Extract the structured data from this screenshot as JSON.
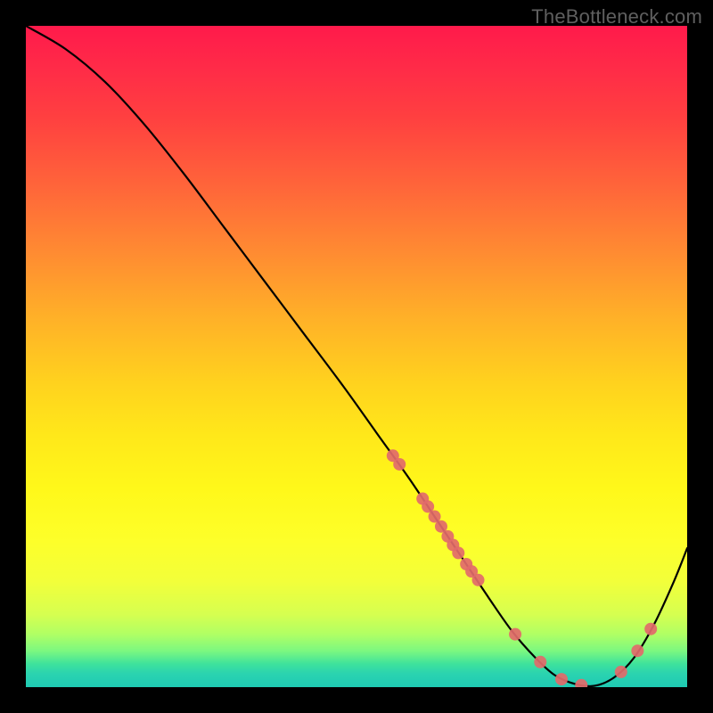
{
  "watermark": "TheBottleneck.com",
  "chart_data": {
    "type": "line",
    "title": "",
    "xlabel": "",
    "ylabel": "",
    "xlim": [
      0,
      100
    ],
    "ylim": [
      0,
      100
    ],
    "grid": false,
    "legend": false,
    "series": [
      {
        "name": "curve",
        "x": [
          0,
          6,
          12,
          18,
          24,
          30,
          36,
          42,
          48,
          53,
          58,
          62,
          66,
          70,
          73.5,
          77,
          80,
          83,
          86,
          89,
          92,
          95,
          98,
          100
        ],
        "y": [
          100,
          96.5,
          91.5,
          85,
          77.5,
          69.5,
          61.5,
          53.5,
          45.5,
          38.5,
          31.5,
          25.5,
          19.5,
          13.5,
          8.5,
          4.5,
          1.8,
          0.5,
          0.2,
          1.5,
          4.5,
          9.5,
          16,
          21
        ]
      }
    ],
    "points": {
      "name": "markers",
      "x": [
        55.5,
        56.5,
        60.0,
        60.8,
        61.8,
        62.8,
        63.8,
        64.6,
        65.4,
        66.6,
        67.4,
        68.4,
        74.0,
        77.8,
        81.0,
        84.0,
        90.0,
        92.5,
        94.5
      ],
      "y": [
        35.0,
        33.7,
        28.5,
        27.3,
        25.8,
        24.3,
        22.8,
        21.5,
        20.3,
        18.6,
        17.5,
        16.2,
        8.0,
        3.8,
        1.2,
        0.3,
        2.3,
        5.5,
        8.8
      ]
    },
    "colors": {
      "curve": "#000000",
      "markers": "#e26a6a",
      "bg_top": "#ff1a4b",
      "bg_bottom": "#1fcab3"
    }
  }
}
